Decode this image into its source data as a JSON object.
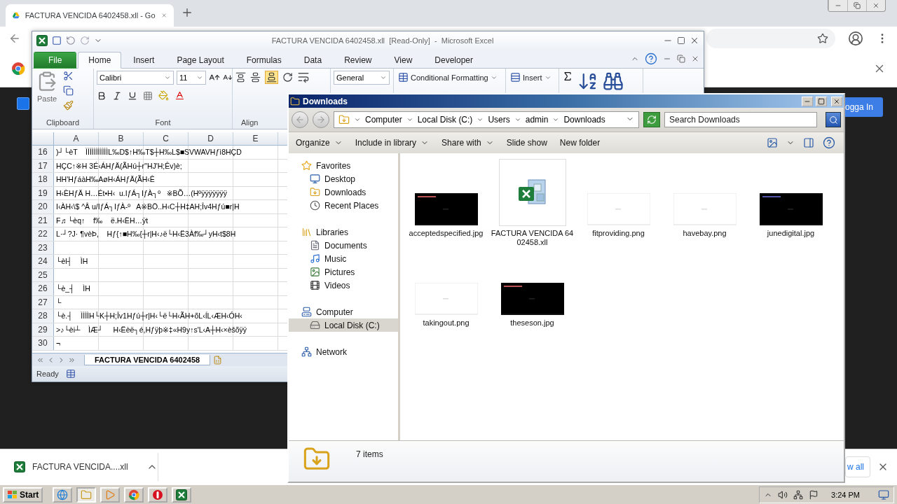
{
  "browser": {
    "tab": {
      "title": "FACTURA VENCIDA 6402458.xll - Go",
      "selected": true
    },
    "sign_in_button": "ogga In"
  },
  "excel": {
    "title": "FACTURA VENCIDA 6402458.xll  [Read-Only]  -  Microsoft Excel",
    "tabs": [
      {
        "label": "File",
        "kind": "file",
        "selected": false
      },
      {
        "label": "Home",
        "kind": "tab",
        "selected": true
      },
      {
        "label": "Insert",
        "kind": "tab",
        "selected": false
      },
      {
        "label": "Page Layout",
        "kind": "tab",
        "selected": false
      },
      {
        "label": "Formulas",
        "kind": "tab",
        "selected": false
      },
      {
        "label": "Data",
        "kind": "tab",
        "selected": false
      },
      {
        "label": "Review",
        "kind": "tab",
        "selected": false
      },
      {
        "label": "View",
        "kind": "tab",
        "selected": false
      },
      {
        "label": "Developer",
        "kind": "tab",
        "selected": false
      }
    ],
    "ribbon": {
      "paste": "Paste",
      "font": "Calibri",
      "size": "11",
      "number_format": "General",
      "conditional_formatting": "Conditional Formatting",
      "insert": "Insert",
      "groups": [
        "Clipboard",
        "Font",
        "Align"
      ]
    },
    "columns": [
      "A",
      "B",
      "C",
      "D",
      "E"
    ],
    "rows": [
      {
        "number": "16",
        "text": ")┘└èT    ÌÌÌÌÌÌÌÌÌÌÌL‰D$↑H‰T$┼H‰L$■SVWAVHƒì8HÇD"
      },
      {
        "number": "17",
        "text": "HÇC↑※H 3É‹ÁHƒÄ(ÃHú┼r''HJ'H;Êv)è;"
      },
      {
        "number": "18",
        "text": "HH'HƒáàH‰AøH‹ÁHƒÄ(ÃH‹Ê"
      },
      {
        "number": "19",
        "text": "H‹ÈHƒÄ H…Ét•H‹  u.IƒÁ┐IƒÀ┐º   ※BÕ…(Hºÿÿÿÿÿÿÿ"
      },
      {
        "number": "20",
        "text": "I‹ÀH‹\\$ ^Â u/IƒÁ┐IƒÀ-º   A※BÖ..H‹C┼H‡AH;Îv4Hƒú■r|H"
      },
      {
        "number": "21",
        "text": "F♬└èq↑    f‰    ë.H‹ËH…ÿt"
      },
      {
        "number": "22",
        "text": "L·┘?J· ¶vèÞ,    Hƒ{↑■H‰{┼r|H‹♪ë└H‹Ë3Àf‰┘yH‹t$8H"
      },
      {
        "number": "23",
        "text": ""
      },
      {
        "number": "24",
        "text": "└èl┤    ÌH"
      },
      {
        "number": "25",
        "text": ""
      },
      {
        "number": "26",
        "text": "└è_┤    ÌH"
      },
      {
        "number": "27",
        "text": "└"
      },
      {
        "number": "28",
        "text": "└è.┤    ÌÌÌÌH└K┼H;Îv1Hƒú┼r|H‹└ë└H‹ÃH+õL‹ÍL‹ÆH‹ÓH‹"
      },
      {
        "number": "29",
        "text": ">♪└èi┴    ÌÆ┘     H‹Ëèë┐é,Hƒÿþ※‡«H9y↑s'L‹A┼H‹×èšõÿÿ"
      },
      {
        "number": "30",
        "text": "¬"
      }
    ],
    "sheet_tab": "FACTURA VENCIDA 6402458",
    "status": "Ready"
  },
  "explorer": {
    "title": "Downloads",
    "breadcrumb": [
      "Computer",
      "Local Disk (C:)",
      "Users",
      "admin",
      "Downloads"
    ],
    "search": {
      "placeholder": "Search Downloads"
    },
    "toolbar": [
      {
        "label": "Organize",
        "dropdown": true
      },
      {
        "label": "Include in library",
        "dropdown": true
      },
      {
        "label": "Share with",
        "dropdown": true
      },
      {
        "label": "Slide show",
        "dropdown": false
      },
      {
        "label": "New folder",
        "dropdown": false
      }
    ],
    "nav": [
      {
        "label": "Favorites",
        "kind": "star",
        "selected": false,
        "children": [
          {
            "label": "Desktop",
            "kind": "desktop",
            "selected": false
          },
          {
            "label": "Downloads",
            "kind": "downloads",
            "selected": false
          },
          {
            "label": "Recent Places",
            "kind": "recent",
            "selected": false
          }
        ]
      },
      {
        "label": "Libraries",
        "kind": "library",
        "selected": false,
        "children": [
          {
            "label": "Documents",
            "kind": "documents",
            "selected": false
          },
          {
            "label": "Music",
            "kind": "music",
            "selected": false
          },
          {
            "label": "Pictures",
            "kind": "pictures",
            "selected": false
          },
          {
            "label": "Videos",
            "kind": "videos",
            "selected": false
          }
        ]
      },
      {
        "label": "Computer",
        "kind": "computer",
        "selected": false,
        "children": [
          {
            "label": "Local Disk (C:)",
            "kind": "disk",
            "selected": true
          }
        ]
      },
      {
        "label": "Network",
        "kind": "network",
        "selected": false
      }
    ],
    "files": [
      {
        "name": "acceptedspecified.jpg",
        "kind": "dark-image"
      },
      {
        "name": "FACTURA VENCIDA 6402458.xll",
        "kind": "excel-addin"
      },
      {
        "name": "fitproviding.png",
        "kind": "light-image"
      },
      {
        "name": "havebay.png",
        "kind": "light-image"
      },
      {
        "name": "junedigital.jpg",
        "kind": "dark-image"
      },
      {
        "name": "takingout.png",
        "kind": "light-image"
      },
      {
        "name": "theseson.jpg",
        "kind": "dark-image"
      }
    ],
    "details": "7 items"
  },
  "download_bar": {
    "file": "FACTURA VENCIDA....xll",
    "show_all": "w all"
  },
  "taskbar": {
    "start": "Start",
    "apps": [
      {
        "kind": "ie",
        "active": false
      },
      {
        "kind": "explorer",
        "active": true
      },
      {
        "kind": "media",
        "active": false
      },
      {
        "kind": "chrome",
        "active": false
      },
      {
        "kind": "opera",
        "active": false
      },
      {
        "kind": "excel",
        "active": false
      }
    ],
    "clock": "3:24 PM"
  }
}
